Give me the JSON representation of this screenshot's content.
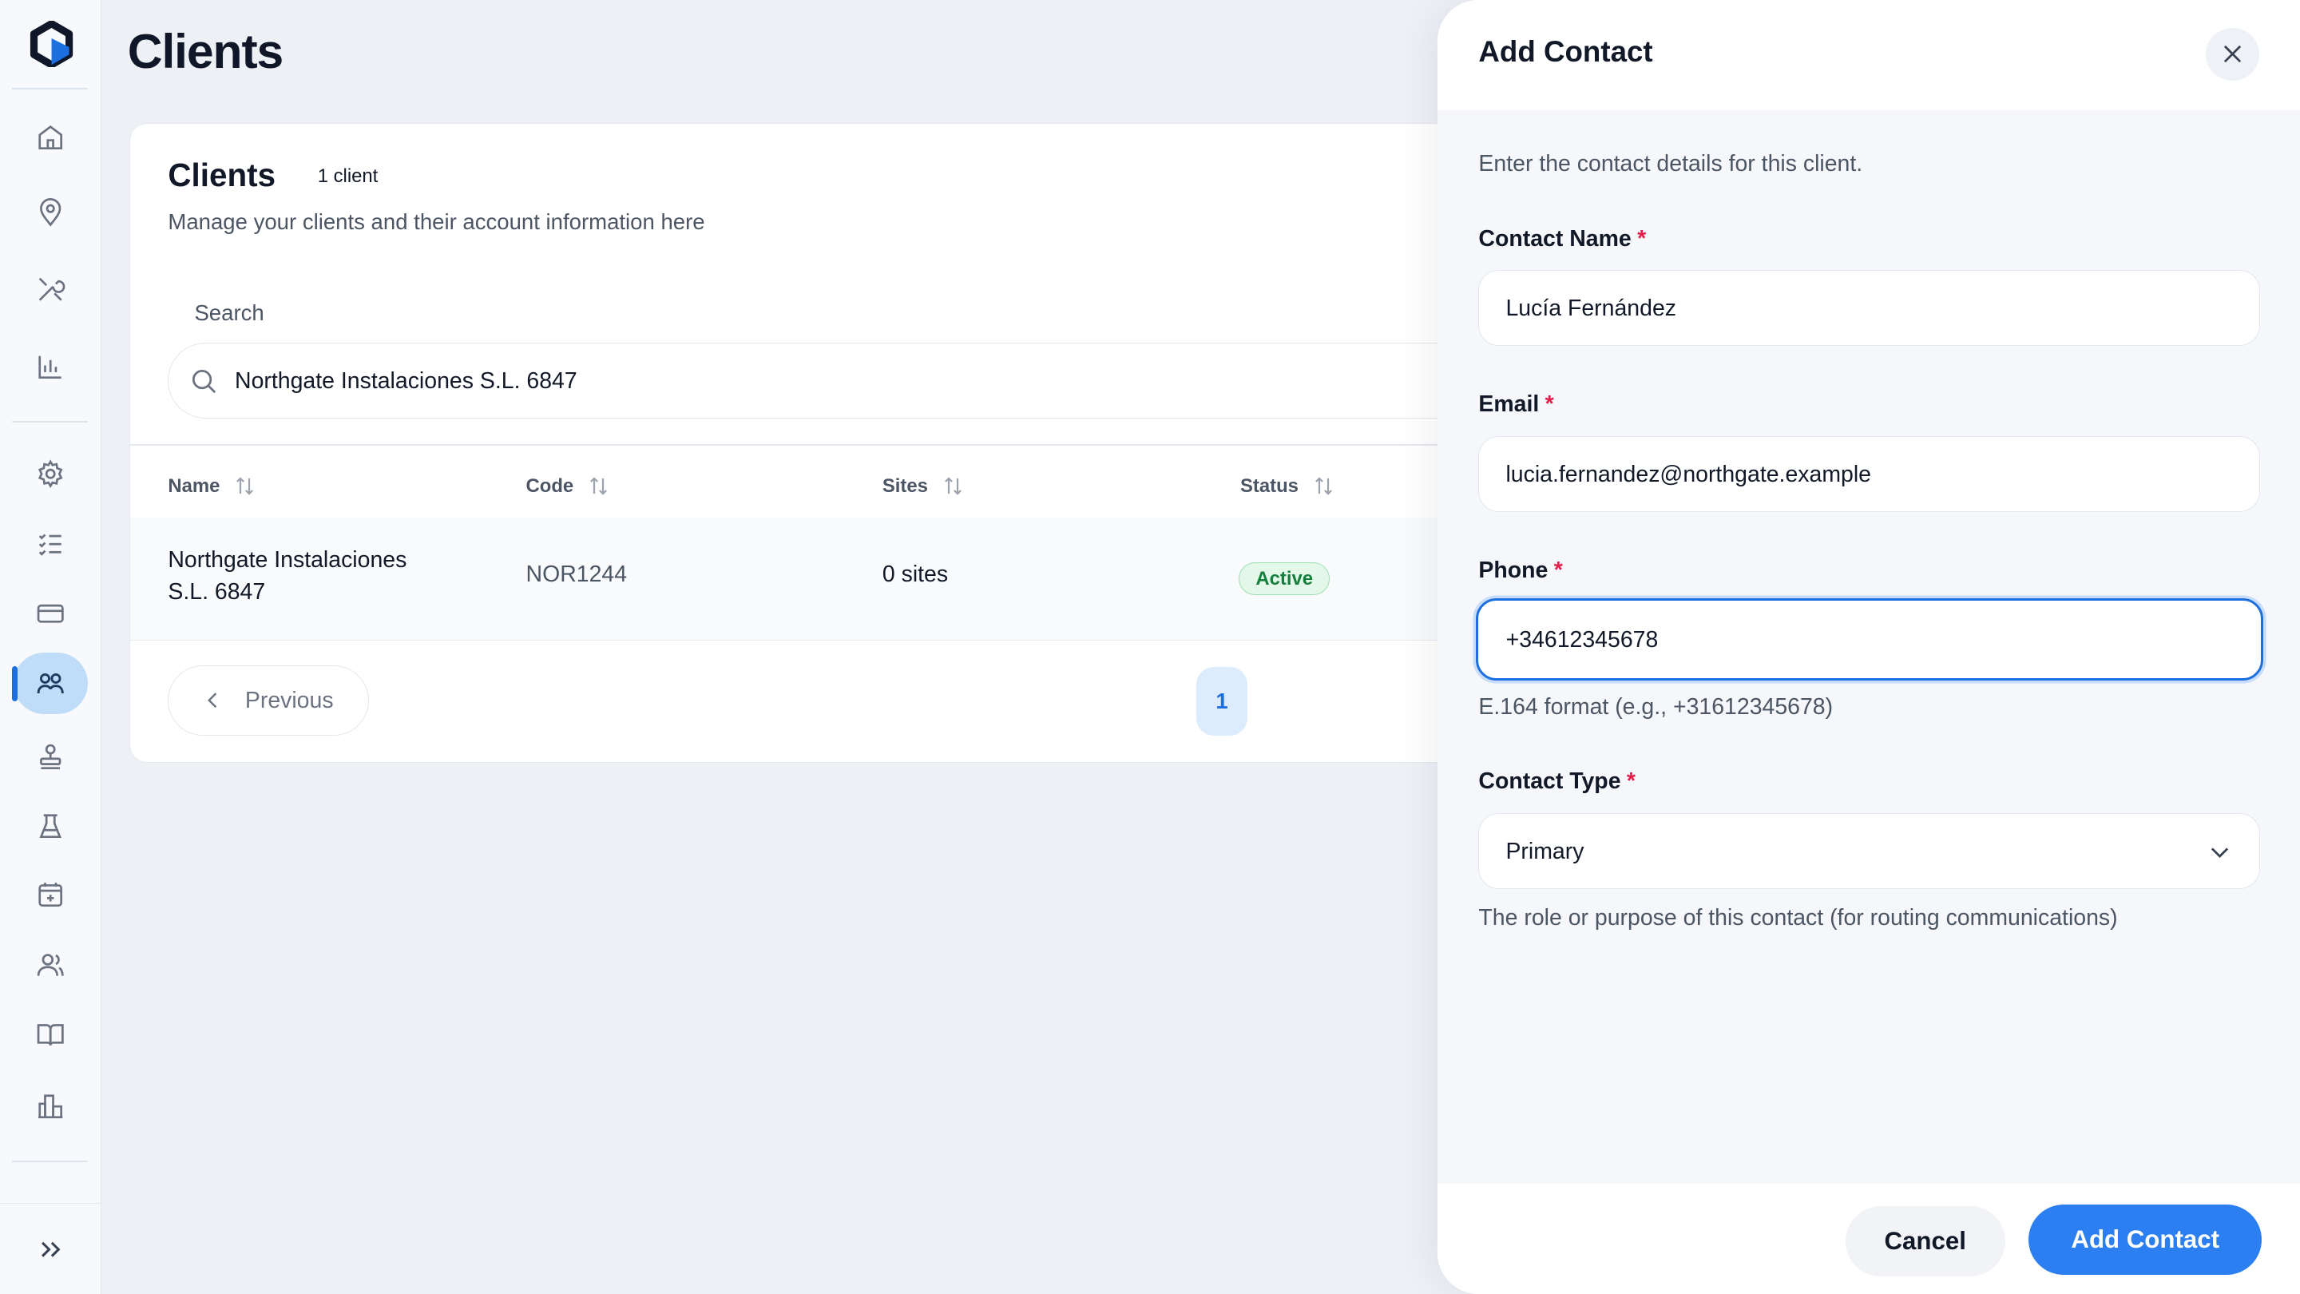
{
  "sidebar": {
    "items": [
      {
        "name": "home",
        "icon": "home-icon"
      },
      {
        "name": "locations",
        "icon": "map-pin-icon"
      },
      {
        "name": "tools",
        "icon": "tools-icon"
      },
      {
        "name": "analytics",
        "icon": "bar-chart-icon"
      },
      {
        "name": "settings",
        "icon": "gear-icon"
      },
      {
        "name": "checklist",
        "icon": "checklist-icon"
      },
      {
        "name": "billing",
        "icon": "credit-card-icon"
      },
      {
        "name": "clients",
        "icon": "users-icon",
        "active": true
      },
      {
        "name": "stamp",
        "icon": "stamp-icon"
      },
      {
        "name": "lab",
        "icon": "flask-icon"
      },
      {
        "name": "calendar",
        "icon": "calendar-icon"
      },
      {
        "name": "team",
        "icon": "team-icon"
      },
      {
        "name": "docs",
        "icon": "book-icon"
      },
      {
        "name": "reports",
        "icon": "buildings-chart-icon"
      }
    ],
    "footer_icon": "double-chevron-right-icon"
  },
  "header": {
    "title": "Clients"
  },
  "card": {
    "title": "Clients",
    "count": "1 client",
    "subtitle": "Manage your clients and their account information here",
    "search_label": "Search",
    "search_value": "Northgate Instalaciones S.L. 6847",
    "columns": [
      "Name",
      "Code",
      "Sites",
      "Status"
    ],
    "rows": [
      {
        "name_line1": "Northgate Instalaciones",
        "name_line2": "S.L. 6847",
        "code": "NOR1244",
        "sites": "0 sites",
        "status": "Active"
      }
    ],
    "pagination": {
      "previous_label": "Previous",
      "current_page": "1"
    }
  },
  "drawer": {
    "title": "Add Contact",
    "description": "Enter the contact details for this client.",
    "required_mark": "*",
    "fields": {
      "name": {
        "label": "Contact Name",
        "value": "Lucía Fernández"
      },
      "email": {
        "label": "Email",
        "value": "lucia.fernandez@northgate.example"
      },
      "phone": {
        "label": "Phone",
        "value": "+34612345678",
        "hint": "E.164 format (e.g., +31612345678)"
      },
      "type": {
        "label": "Contact Type",
        "value": "Primary",
        "hint": "The role or purpose of this contact (for routing communications)"
      }
    },
    "cancel_label": "Cancel",
    "submit_label": "Add Contact"
  },
  "colors": {
    "accent": "#2b7ff0",
    "active_badge": "#15803d",
    "required": "#e11d48"
  }
}
